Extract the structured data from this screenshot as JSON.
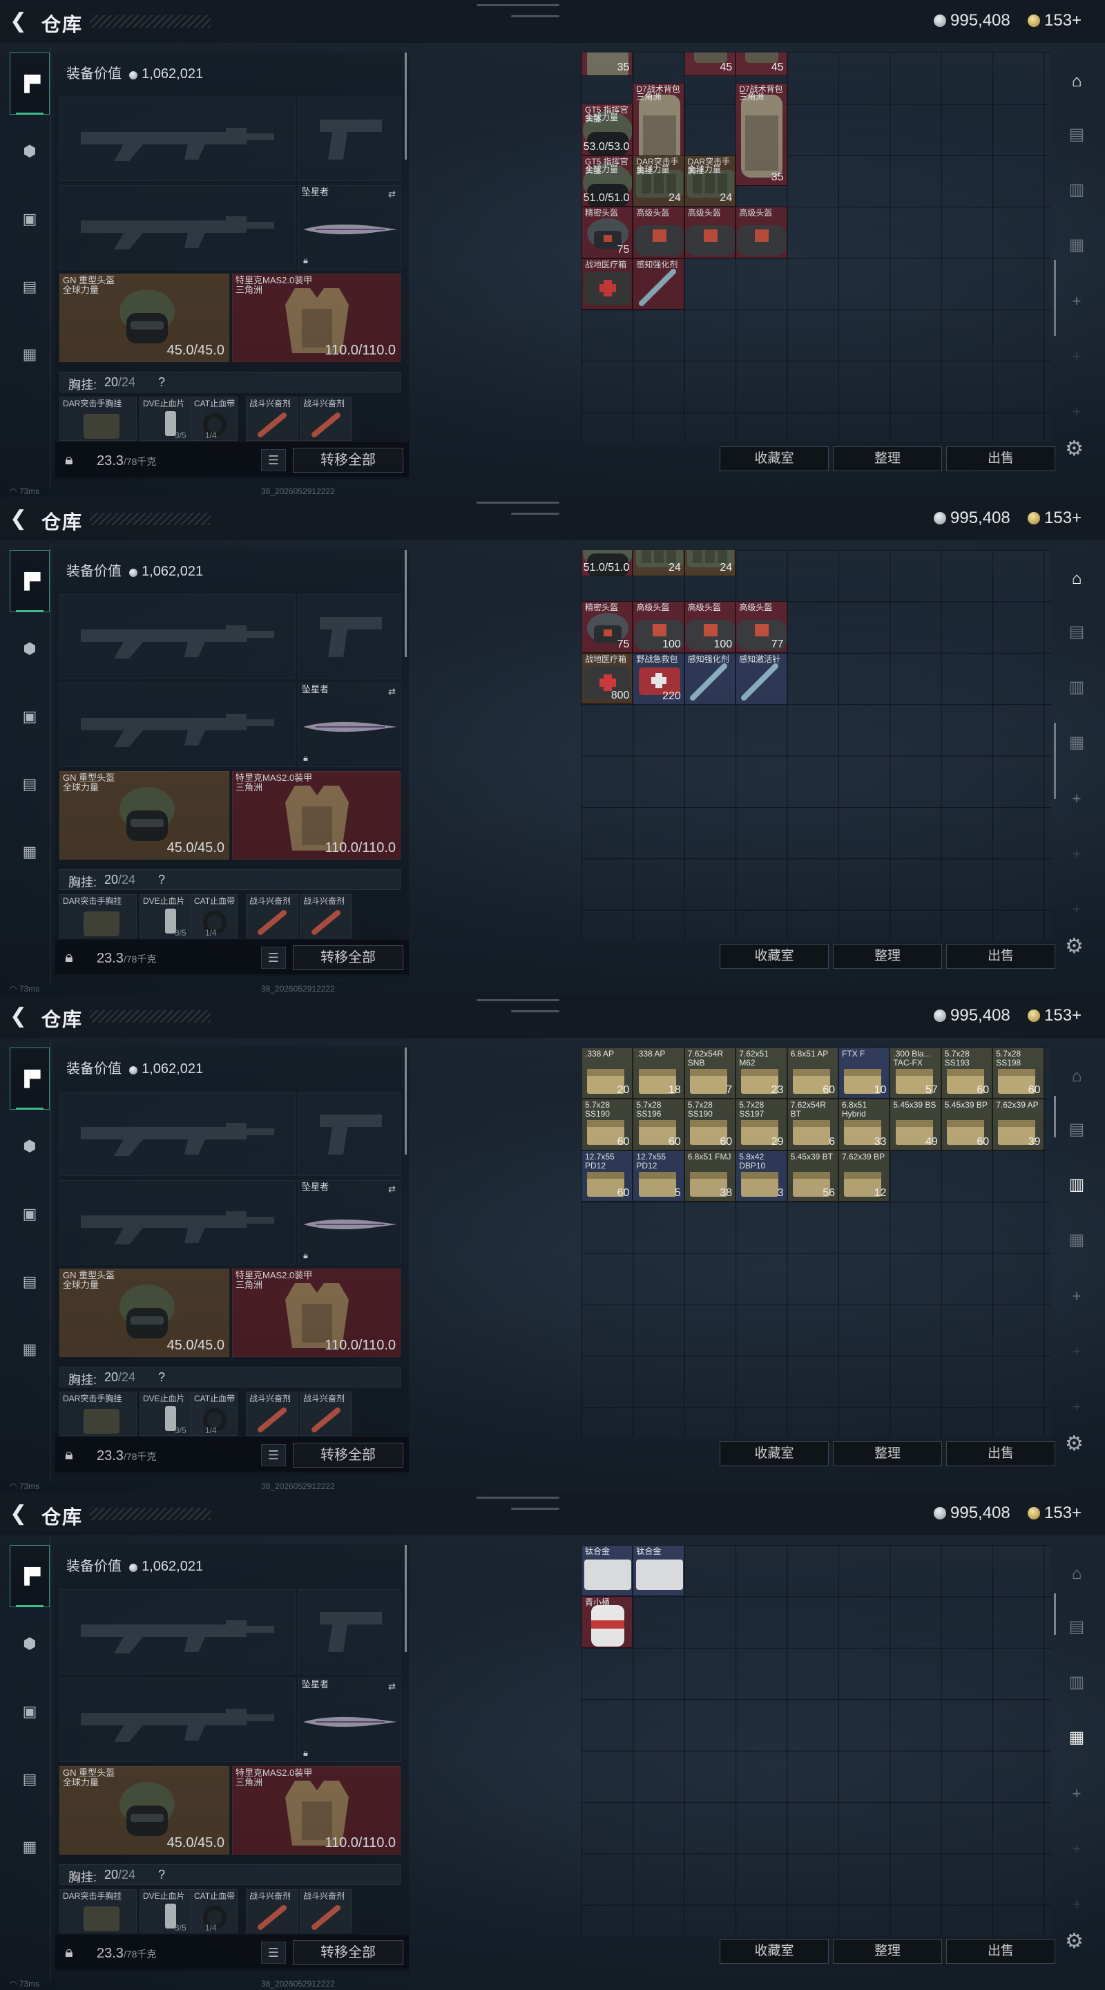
{
  "header": {
    "title": "仓库",
    "silver": "995,408",
    "gold": "153",
    "gold_add": "+"
  },
  "loadout": {
    "value_label": "装备价值",
    "value": "1,062,021",
    "knife_name": "坠星者",
    "helmet": {
      "name": "GN 重型头盔",
      "tag": "全球力量",
      "dur": "45.0/45.0"
    },
    "armor": {
      "name": "特里克MAS2.0装甲",
      "tag": "三角洲",
      "dur": "110.0/110.0"
    },
    "chest_label": "胸挂:",
    "chest_cur": "20",
    "chest_max": "/24",
    "chest_help": "?",
    "mini": [
      {
        "name": "DAR突击手胸挂",
        "cnt": ""
      },
      {
        "name": "DVE止血片",
        "cnt": "3/5"
      },
      {
        "name": "CAT止血带",
        "cnt": "1/4"
      },
      {
        "name": "战斗兴奋剂",
        "cnt": ""
      },
      {
        "name": "战斗兴奋剂",
        "cnt": ""
      }
    ],
    "weight": "23.3",
    "weight_max": "/78千克",
    "transfer": "转移全部"
  },
  "status": {
    "ping": "73ms",
    "build": "38_2026052912222"
  },
  "buttons": {
    "collection": "收藏室",
    "sort": "整理",
    "sell": "出售"
  },
  "frames": [
    {
      "items": [
        {
          "name": "",
          "tag": "",
          "qty": "35"
        },
        {
          "name": "",
          "tag": "",
          "qty": "45"
        },
        {
          "name": "",
          "tag": "",
          "qty": "45"
        },
        {
          "name": "D7战术背包",
          "tag": "三角洲",
          "qty": "35"
        },
        {
          "name": "D7战术背包",
          "tag": "三角洲",
          "qty": "35"
        },
        {
          "name": "GT5 指挥官头盔",
          "tag": "全球力量",
          "qty": "53.0/53.0"
        },
        {
          "name": "GT5 指挥官头盔",
          "tag": "全球力量",
          "qty": "51.0/51.0"
        },
        {
          "name": "DAR突击手胸挂",
          "tag": "全球力量",
          "qty": "24"
        },
        {
          "name": "DAR突击手胸挂",
          "tag": "全球力量",
          "qty": "24"
        },
        {
          "name": "精密头盔",
          "tag": "",
          "qty": "75"
        },
        {
          "name": "高级头盔",
          "tag": "",
          "qty": ""
        },
        {
          "name": "高级头盔",
          "tag": "",
          "qty": ""
        },
        {
          "name": "高级头盔",
          "tag": "",
          "qty": ""
        },
        {
          "name": "战地医疗箱",
          "tag": "",
          "qty": ""
        },
        {
          "name": "感知强化剂",
          "tag": "",
          "qty": ""
        }
      ]
    },
    {
      "items": [
        {
          "name": "",
          "tag": "",
          "qty": "51.0/51.0"
        },
        {
          "name": "",
          "tag": "",
          "qty": "24"
        },
        {
          "name": "",
          "tag": "",
          "qty": "24"
        },
        {
          "name": "精密头盔",
          "tag": "",
          "qty": "75"
        },
        {
          "name": "高级头盔",
          "tag": "",
          "qty": "100"
        },
        {
          "name": "高级头盔",
          "tag": "",
          "qty": "100"
        },
        {
          "name": "高级头盔",
          "tag": "",
          "qty": "77"
        },
        {
          "name": "战地医疗箱",
          "tag": "",
          "qty": "800"
        },
        {
          "name": "感知强化剂",
          "tag": "",
          "qty": ""
        },
        {
          "name": "野战急救包",
          "tag": "",
          "qty": "220"
        },
        {
          "name": "感知强化剂",
          "tag": "",
          "qty": ""
        },
        {
          "name": "感知激活针",
          "tag": "",
          "qty": ""
        }
      ]
    },
    {
      "items": [
        {
          "name": ".338 AP",
          "qty": "20"
        },
        {
          "name": ".338 AP",
          "qty": "18"
        },
        {
          "name": "7.62x54R SNB",
          "qty": "7"
        },
        {
          "name": "7.62x51 M62",
          "qty": "23"
        },
        {
          "name": "6.8x51 AP",
          "qty": "60"
        },
        {
          "name": "FTX F",
          "qty": "10"
        },
        {
          "name": ".300 Bla... TAC-FX",
          "qty": "57"
        },
        {
          "name": "5.7x28 SS193",
          "qty": "60"
        },
        {
          "name": "5.7x28 SS198",
          "qty": "60"
        },
        {
          "name": "5.7x28 SS190",
          "qty": "60"
        },
        {
          "name": "5.7x28 SS196",
          "qty": "60"
        },
        {
          "name": "5.7x28 SS190",
          "qty": "60"
        },
        {
          "name": "5.7x28 SS197",
          "qty": "29"
        },
        {
          "name": "7.62x54R BT",
          "qty": "6"
        },
        {
          "name": "6.8x51 Hybrid",
          "qty": "33"
        },
        {
          "name": "5.45x39 BS",
          "qty": "49"
        },
        {
          "name": "5.45x39 BP",
          "qty": "60"
        },
        {
          "name": "7.62x39 AP",
          "qty": "39"
        },
        {
          "name": "12.7x55 PD12",
          "qty": "60"
        },
        {
          "name": "12.7x55 PD12",
          "qty": "5"
        },
        {
          "name": "6.8x51 FMJ",
          "qty": "38"
        },
        {
          "name": "5.8x42 DBP10",
          "qty": "3"
        },
        {
          "name": "5.45x39 BT",
          "qty": "56"
        },
        {
          "name": "7.62x39 BP",
          "qty": "12"
        }
      ]
    },
    {
      "items": [
        {
          "name": "钛合金",
          "qty": ""
        },
        {
          "name": "钛合金",
          "qty": ""
        },
        {
          "name": "青小桶",
          "qty": ""
        }
      ]
    }
  ]
}
